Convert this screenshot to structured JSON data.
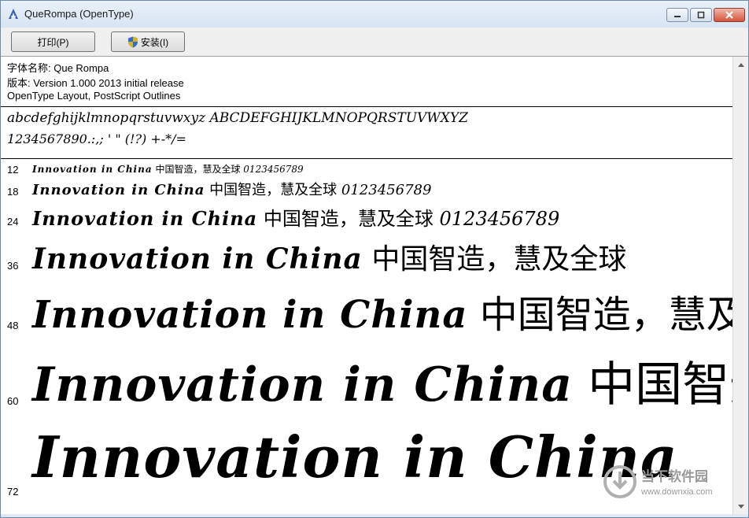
{
  "window": {
    "title": "QueRompa (OpenType)",
    "icon": "font-file-icon"
  },
  "toolbar": {
    "print_label": "打印(P)",
    "install_label": "安装(I)"
  },
  "info": {
    "font_name": "字体名称: Que Rompa",
    "version": "版本: Version 1.000 2013 initial release",
    "layout": "OpenType Layout, PostScript Outlines"
  },
  "charset": {
    "letters": "abcdefghijklmnopqrstuvwxyz ABCDEFGHIJKLMNOPQRSTUVWXYZ",
    "digits_symbols": "1234567890.:,; ' \" (!?) +-*/="
  },
  "samples": {
    "latin": "Innovation in China",
    "cjk": "中国智造，慧及全球",
    "digits": "0123456789",
    "rows": [
      {
        "size": "12"
      },
      {
        "size": "18"
      },
      {
        "size": "24"
      },
      {
        "size": "36"
      },
      {
        "size": "48"
      },
      {
        "size": "60"
      },
      {
        "size": "72"
      }
    ]
  },
  "watermark": {
    "brand": "当下软件园",
    "url": "www.downxia.com"
  },
  "colors": {
    "titlebar": "#dfe8f3",
    "close_button": "#d9533a",
    "content_bg": "#ffffff"
  }
}
